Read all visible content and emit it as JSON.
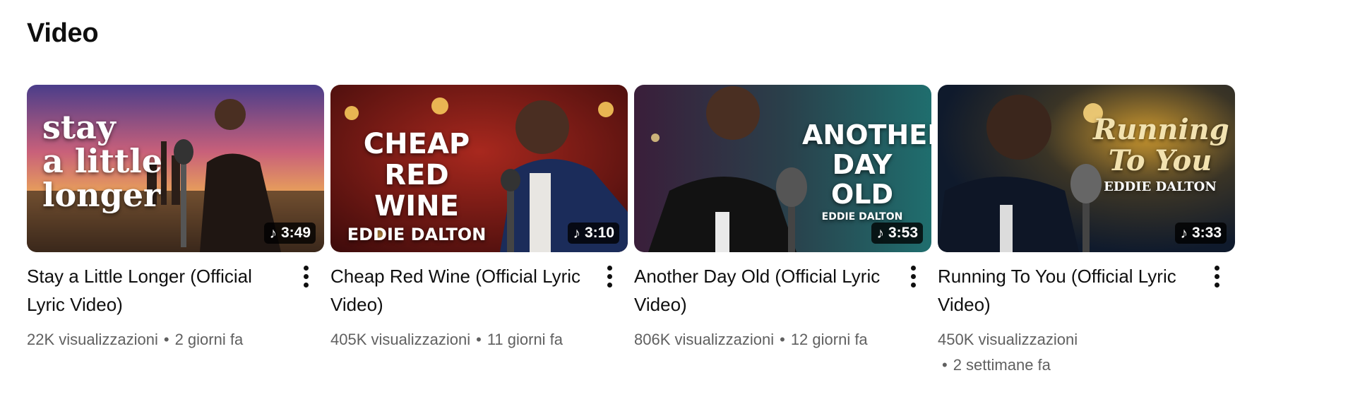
{
  "section": {
    "title": "Video"
  },
  "videos": [
    {
      "thumb_text": [
        "stay",
        "a little",
        "longer"
      ],
      "duration": "3:49",
      "title": "Stay a Little Longer (Official Lyric Video)",
      "views": "22K visualizzazioni",
      "age": "2 giorni fa"
    },
    {
      "thumb_text": [
        "CHEAP",
        "RED WINE",
        "EDDIE DALTON"
      ],
      "duration": "3:10",
      "title": "Cheap Red Wine (Official Lyric Video)",
      "views": "405K visualizzazioni",
      "age": "11 giorni fa"
    },
    {
      "thumb_text": [
        "ANOTHER",
        "DAY OLD",
        "EDDIE DALTON"
      ],
      "duration": "3:53",
      "title": "Another Day Old (Official Lyric Video)",
      "views": "806K visualizzazioni",
      "age": "12 giorni fa"
    },
    {
      "thumb_text": [
        "Running",
        "To You",
        "EDDIE DALTON"
      ],
      "duration": "3:33",
      "title": "Running To You (Official Lyric Video)",
      "views": "450K visualizzazioni",
      "age": "2 settimane fa"
    }
  ],
  "icons": {
    "music_note": "music-note-icon",
    "more": "more-vert-icon"
  }
}
